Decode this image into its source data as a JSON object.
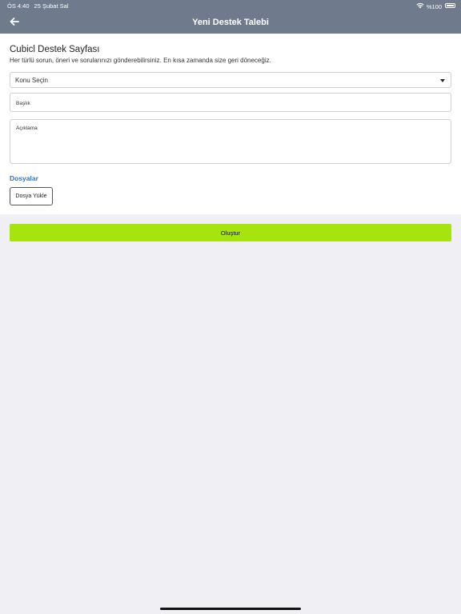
{
  "status_bar": {
    "time": "ÖS 4:40",
    "date": "25 Şubat Sal",
    "battery_text": "%100",
    "wifi_icon": "wifi-icon",
    "battery_icon": "battery-icon"
  },
  "nav": {
    "title": "Yeni Destek Talebi",
    "back_icon": "arrow-left-icon"
  },
  "form": {
    "heading": "Cubicl Destek Sayfası",
    "subheading": "Her türlü sorun, öneri ve sorularınızı gönderebilirsiniz. En kısa zamanda size geri döneceğiz.",
    "topic_select": "Konu Seçin",
    "title_placeholder": "Başlık",
    "description_placeholder": "Açıklama",
    "files_label": "Dosyalar",
    "upload_label": "Dosya Yükle",
    "submit_label": "Oluştur"
  },
  "colors": {
    "header_bg": "#6f7a8c",
    "accent_link": "#2a74c6",
    "submit_bg": "#a6e40e",
    "page_bg": "#efeff4"
  }
}
